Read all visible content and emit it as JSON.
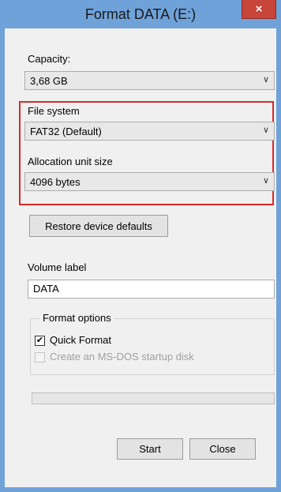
{
  "window": {
    "title": "Format DATA (E:)",
    "close_glyph": "×"
  },
  "capacity": {
    "label": "Capacity:",
    "value": "3,68 GB"
  },
  "file_system": {
    "label": "File system",
    "value": "FAT32 (Default)"
  },
  "allocation": {
    "label": "Allocation unit size",
    "value": "4096 bytes"
  },
  "restore_button": "Restore device defaults",
  "volume": {
    "label": "Volume label",
    "value": "DATA"
  },
  "format_options": {
    "title": "Format options",
    "quick_format": {
      "label": "Quick Format",
      "checked": true
    },
    "msdos_disk": {
      "label": "Create an MS-DOS startup disk",
      "checked": false,
      "disabled": true
    }
  },
  "progress": {
    "fraction": 0
  },
  "buttons": {
    "start": "Start",
    "close": "Close"
  },
  "icons": {
    "dropdown": "chevron-down-icon",
    "close": "close-icon",
    "check": "checkmark-icon"
  },
  "colors": {
    "title_bar": "#6fa2d9",
    "close_button": "#c8453a",
    "highlight_box": "#d62b2b"
  }
}
